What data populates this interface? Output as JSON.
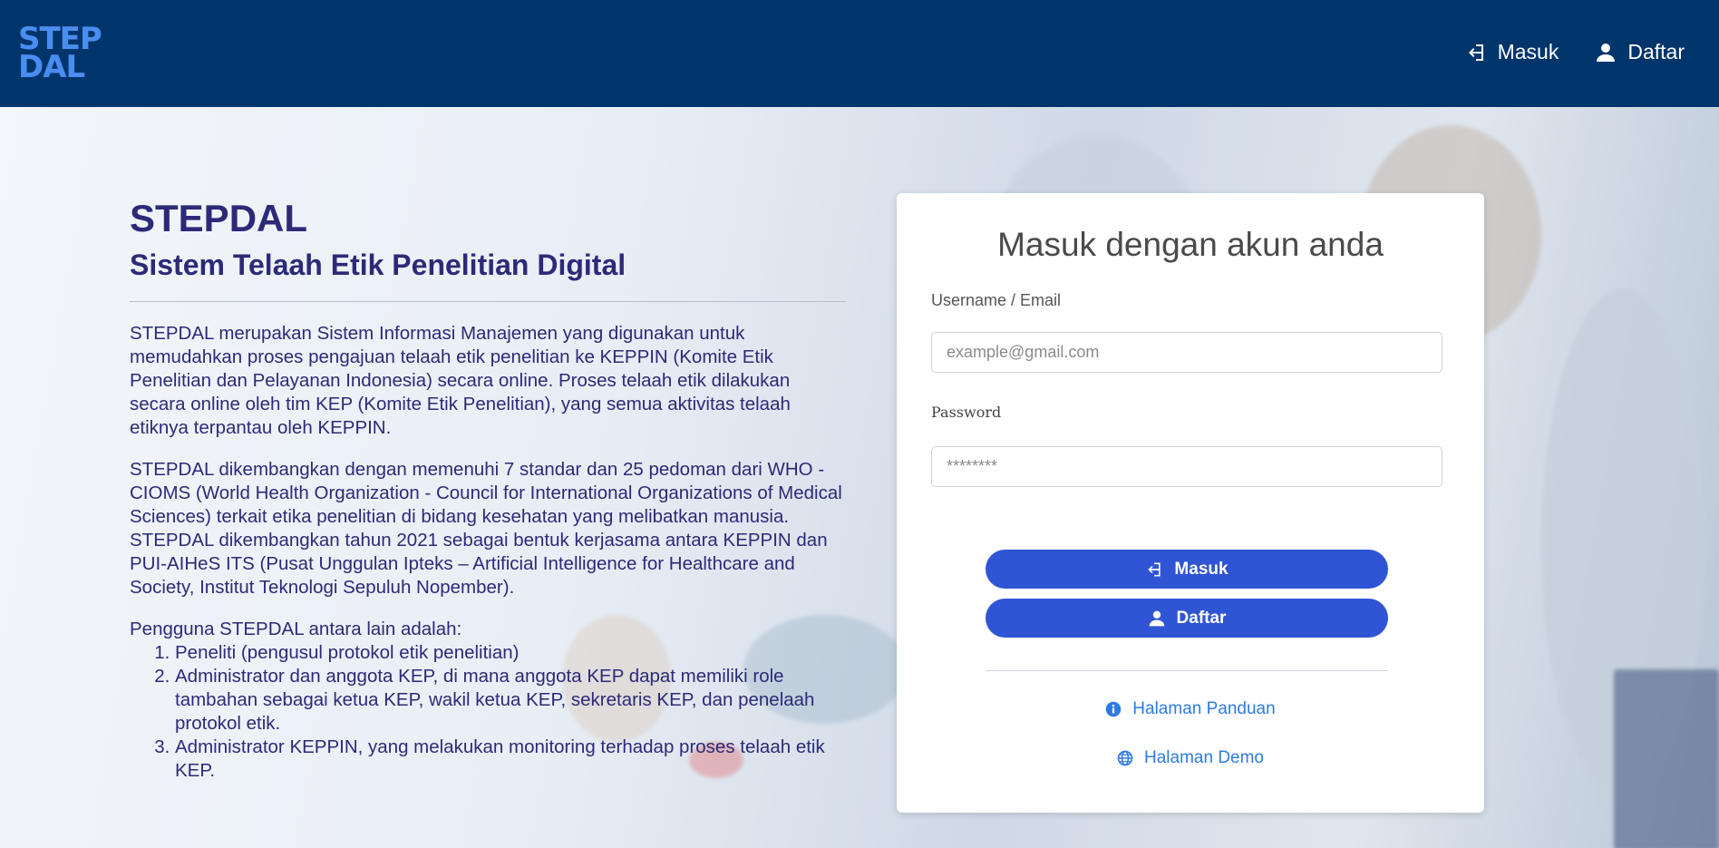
{
  "header": {
    "logo_line1": "STEP",
    "logo_line2": "DAL",
    "nav": [
      {
        "label": "Masuk",
        "icon": "sign-in-icon"
      },
      {
        "label": "Daftar",
        "icon": "user-icon"
      }
    ]
  },
  "intro": {
    "title": "STEPDAL",
    "subtitle": "Sistem Telaah Etik Penelitian Digital",
    "paragraph1": "STEPDAL merupakan Sistem Informasi Manajemen yang digunakan untuk memudahkan proses pengajuan telaah etik penelitian ke KEPPIN (Komite Etik Penelitian dan Pelayanan Indonesia) secara online. Proses telaah etik dilakukan secara online oleh tim KEP (Komite Etik Penelitian), yang semua aktivitas telaah etiknya terpantau oleh KEPPIN.",
    "paragraph2": "STEPDAL dikembangkan dengan memenuhi 7 standar dan 25 pedoman dari WHO - CIOMS (World Health Organization - Council for International Organizations of Medical Sciences) terkait etika penelitian di bidang kesehatan yang melibatkan manusia. STEPDAL dikembangkan tahun 2021 sebagai bentuk kerjasama antara KEPPIN dan PUI-AIHeS ITS (Pusat Unggulan Ipteks – Artificial Intelligence for Healthcare and Society, Institut Teknologi Sepuluh Nopember).",
    "list_heading": "Pengguna STEPDAL antara lain adalah:",
    "list_items": [
      "Peneliti (pengusul protokol etik penelitian)",
      "Administrator dan anggota KEP, di mana anggota KEP dapat memiliki role tambahan sebagai ketua KEP, wakil ketua KEP, sekretaris KEP, dan penelaah protokol etik.",
      "Administrator KEPPIN, yang melakukan monitoring terhadap proses telaah etik KEP."
    ]
  },
  "login": {
    "title": "Masuk dengan akun anda",
    "username_label": "Username / Email",
    "username_placeholder": "example@gmail.com",
    "password_label": "Password",
    "password_placeholder": "********",
    "login_button": "Masuk",
    "register_button": "Daftar",
    "guide_link": "Halaman Panduan",
    "demo_link": "Halaman Demo"
  },
  "colors": {
    "header_bg": "#00356b",
    "logo": "#4a8df0",
    "button": "#2f55d4",
    "link": "#2d7be6",
    "heading": "#2c2a78"
  }
}
